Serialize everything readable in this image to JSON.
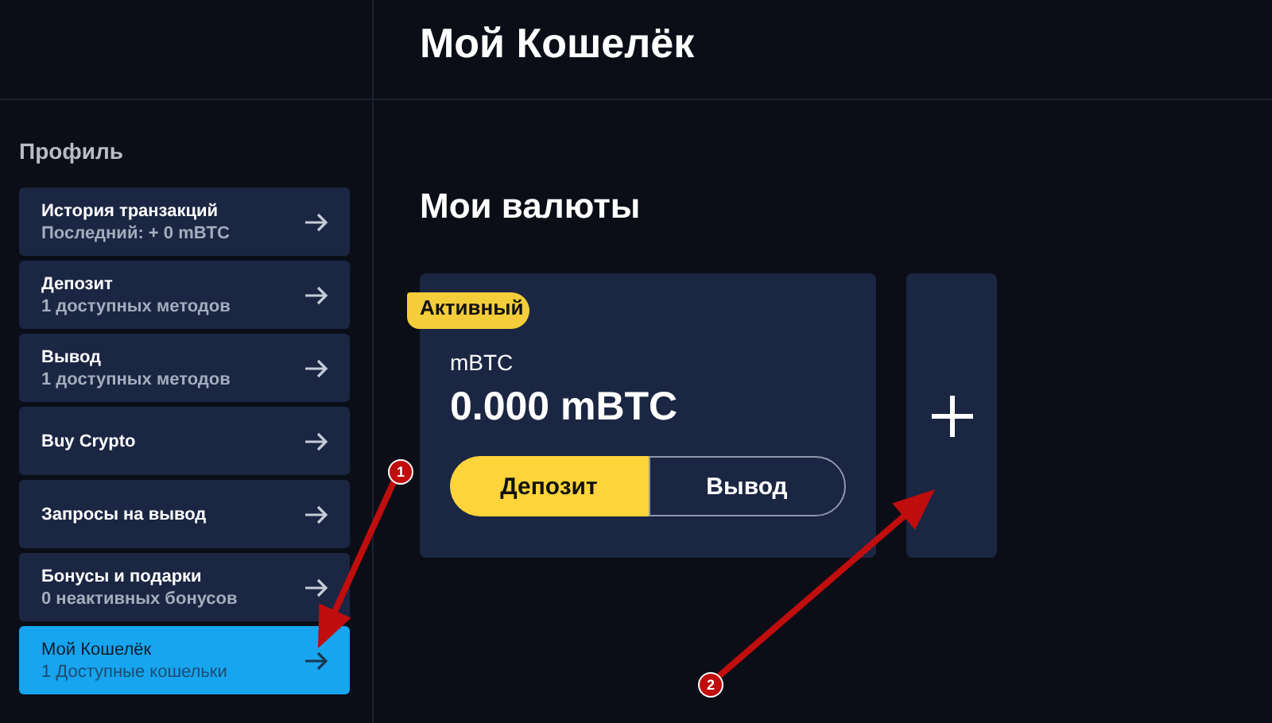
{
  "page_title": "Мой Кошелёк",
  "sidebar": {
    "heading": "Профиль",
    "items": [
      {
        "title": "История транзакций",
        "subtitle": "Последний: + 0 mBTC",
        "selected": false
      },
      {
        "title": "Депозит",
        "subtitle": "1 доступных методов",
        "selected": false
      },
      {
        "title": "Вывод",
        "subtitle": "1 доступных методов",
        "selected": false
      },
      {
        "title": "Buy Crypto",
        "selected": false
      },
      {
        "title": "Запросы на вывод",
        "selected": false
      },
      {
        "title": "Бонусы и подарки",
        "subtitle": "0 неактивных бонусов",
        "selected": false
      },
      {
        "title": "Мой Кошелёк",
        "subtitle": "1 Доступные кошельки",
        "selected": true
      }
    ]
  },
  "section_title": "Мои валюты",
  "wallets": [
    {
      "badge": "Активный",
      "currency": "mBTC",
      "amount": "0.000 mBTC",
      "buttons": [
        {
          "label": "Депозит",
          "kind": "primary"
        },
        {
          "label": "Вывод",
          "kind": "outline"
        }
      ]
    }
  ],
  "annotations": [
    {
      "label": "1"
    },
    {
      "label": "2"
    }
  ]
}
